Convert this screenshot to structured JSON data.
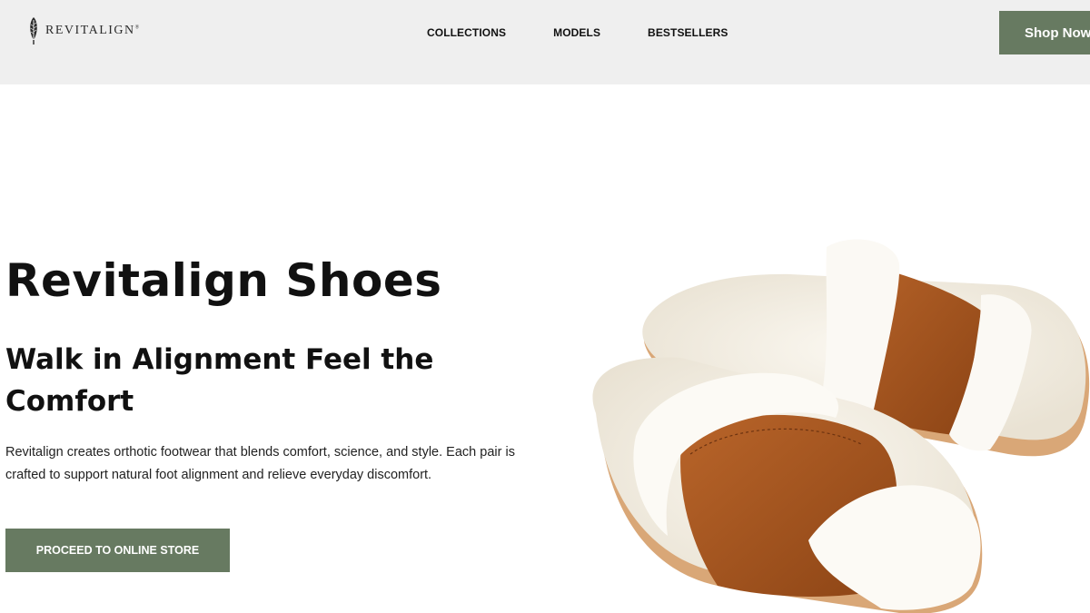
{
  "header": {
    "brand": "REVITALIGN",
    "nav": [
      "COLLECTIONS",
      "MODELS",
      "BESTSELLERS"
    ],
    "shop_button": "Shop Now"
  },
  "hero": {
    "title": "Revitalign Shoes",
    "subtitle": "Walk in Alignment Feel the Comfort",
    "description": "Revitalign creates orthotic footwear that blends comfort, science, and style. Each pair is crafted to support natural foot alignment and relieve everyday discomfort.",
    "cta_label": "PROCEED TO ONLINE STORE"
  },
  "colors": {
    "accent": "#677a61",
    "header_bg": "#efefef",
    "suede": "#a85a22",
    "fleece": "#f5f1e8"
  },
  "icons": {
    "logo": "feather-logo-icon"
  }
}
